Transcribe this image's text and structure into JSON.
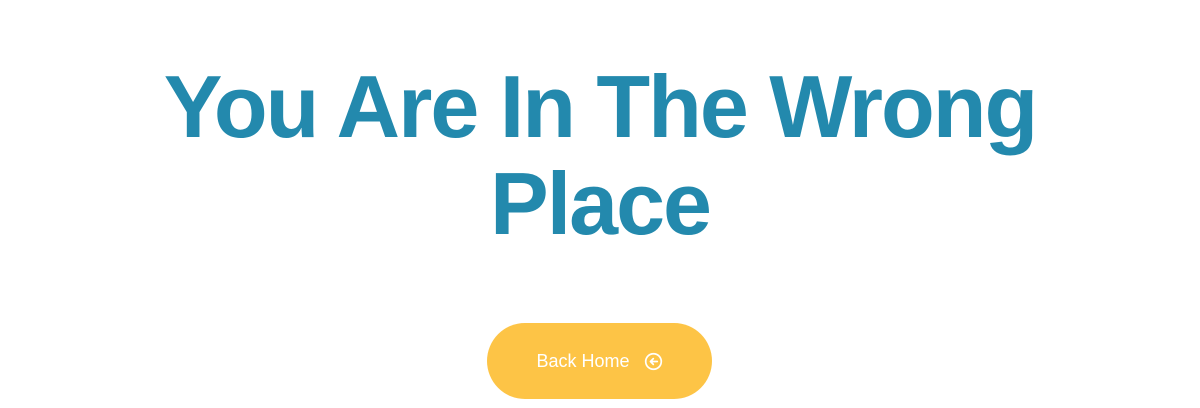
{
  "heading": {
    "line1": "You Are In The Wrong",
    "line2": "Place"
  },
  "back_home_button": {
    "label": "Back Home",
    "icon": "arrow-left-circle-icon",
    "color": "#fdc446"
  },
  "colors": {
    "heading": "#2389ad",
    "background": "#ffffff"
  }
}
